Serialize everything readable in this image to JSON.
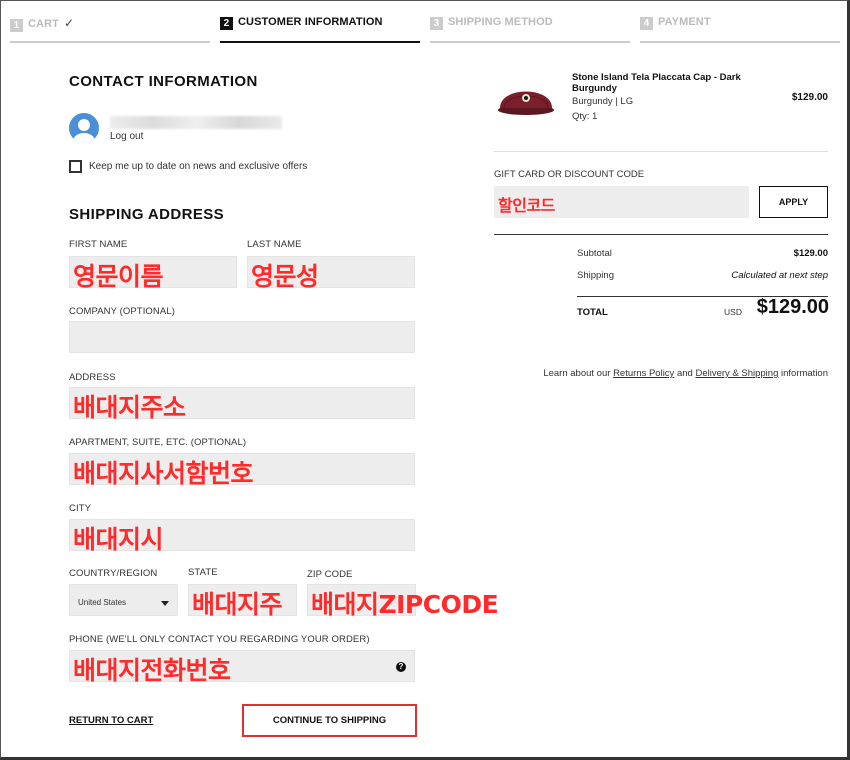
{
  "steps": [
    {
      "num": "1",
      "label": "CART",
      "check": "✓"
    },
    {
      "num": "2",
      "label": "CUSTOMER INFORMATION"
    },
    {
      "num": "3",
      "label": "SHIPPING METHOD"
    },
    {
      "num": "4",
      "label": "PAYMENT"
    }
  ],
  "contact": {
    "title": "CONTACT INFORMATION",
    "logout": "Log out",
    "newsletter_label": "Keep me up to date on news and exclusive offers"
  },
  "shipping": {
    "title": "SHIPPING ADDRESS",
    "first_name_label": "FIRST NAME",
    "first_name_value": "영문이름",
    "last_name_label": "LAST NAME",
    "last_name_value": "영문성",
    "company_label": "COMPANY (OPTIONAL)",
    "company_value": "",
    "address_label": "ADDRESS",
    "address_value": "배대지주소",
    "apartment_label": "APARTMENT, SUITE, ETC. (OPTIONAL)",
    "apartment_value": "배대지사서함번호",
    "city_label": "CITY",
    "city_value": "배대지시",
    "country_label": "COUNTRY/REGION",
    "country_value": "United States",
    "state_label": "STATE",
    "state_value": "배대지주",
    "zip_label": "ZIP CODE",
    "zip_value": "배대지ZIPCODE",
    "phone_label": "PHONE (WE'LL ONLY CONTACT YOU REGARDING YOUR ORDER)",
    "phone_value": "배대지전화번호",
    "help_glyph": "?"
  },
  "actions": {
    "return_to_cart": "RETURN TO CART",
    "continue": "CONTINUE TO SHIPPING"
  },
  "order": {
    "product_name": "Stone Island Tela Placcata Cap - Dark Burgundy",
    "variant": "Burgundy | LG",
    "qty": "Qty: 1",
    "price": "$129.00",
    "gift_label": "GIFT CARD OR DISCOUNT CODE",
    "gift_value": "할인코드",
    "apply": "APPLY",
    "subtotal_label": "Subtotal",
    "subtotal_value": "$129.00",
    "shipping_label": "Shipping",
    "shipping_value": "Calculated at next step",
    "total_label": "TOTAL",
    "currency": "USD",
    "total_value": "$129.00",
    "learn_prefix": "Learn about our",
    "returns_link": "Returns Policy",
    "and": "and",
    "delivery_link": "Delivery & Shipping",
    "learn_suffix": "information"
  },
  "colors": {
    "accent": "#111111",
    "annotation": "#ff2a2a",
    "field_bg": "#ededed",
    "product_cap": "#7a1f2b"
  }
}
